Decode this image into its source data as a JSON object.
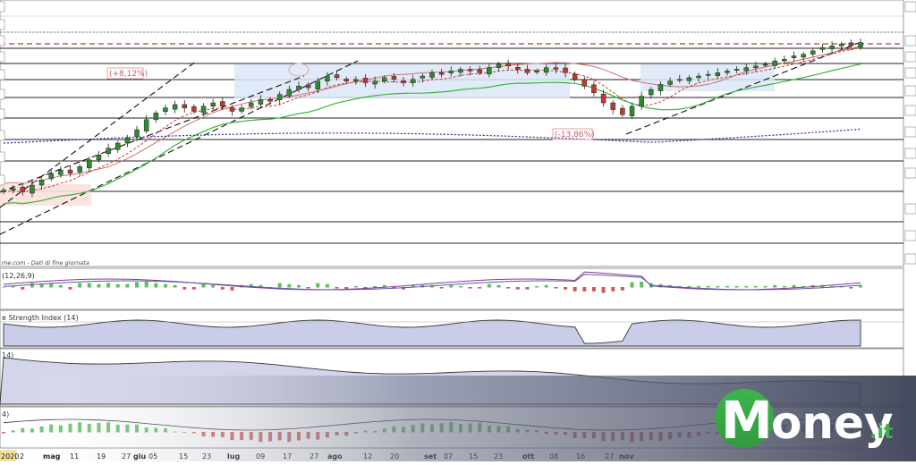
{
  "chart_data": {
    "type": "candlestick",
    "panels": [
      "price",
      "macd",
      "rsi",
      "indicator",
      "histogram"
    ],
    "annotations": {
      "gain_label": "(+8,12%)",
      "loss_label": "(-13,86%)"
    },
    "source_note": "me.com - Dati di fine giornata",
    "macd_title": "(12,26,9)",
    "rsi_title": "e Strength Index (14)",
    "indicator_title": "14)",
    "histogram_title": "4)",
    "x_tick_labels": [
      "2020",
      "2",
      "mag",
      "11",
      "19",
      "27",
      "giu",
      "05",
      "15",
      "23",
      "lug",
      "09",
      "17",
      "27",
      "ago",
      "12",
      "20",
      "set",
      "07",
      "15",
      "23",
      "ott",
      "08",
      "16",
      "27",
      "nov"
    ],
    "close_values": [
      100,
      101,
      99,
      103,
      106,
      110,
      112,
      110,
      114,
      118,
      121,
      125,
      128,
      131,
      136,
      142,
      146,
      149,
      151,
      149,
      147,
      150,
      152,
      150,
      147,
      149,
      152,
      154,
      153,
      157,
      160,
      162,
      161,
      165,
      168,
      167,
      165,
      166,
      164,
      165,
      167,
      166,
      164,
      166,
      168,
      170,
      169,
      171,
      172,
      171,
      170,
      173,
      175,
      174,
      172,
      170,
      171,
      173,
      172,
      170,
      166,
      162,
      158,
      152,
      148,
      145,
      150,
      156,
      160,
      163,
      165,
      166,
      167,
      168,
      169,
      170,
      171,
      172,
      173,
      174,
      175,
      177,
      178,
      180,
      181,
      183,
      185,
      186,
      187,
      186,
      188
    ]
  },
  "brand": {
    "name_a": "M",
    "name_b": "oney",
    "tld": ".it"
  },
  "colors": {
    "up": "#2e8b2e",
    "down": "#c0392b",
    "support": "#3cb43c",
    "ma_red": "#d03a3a",
    "ma_blue": "#2a2aa8",
    "band": "#dbe6f7"
  }
}
